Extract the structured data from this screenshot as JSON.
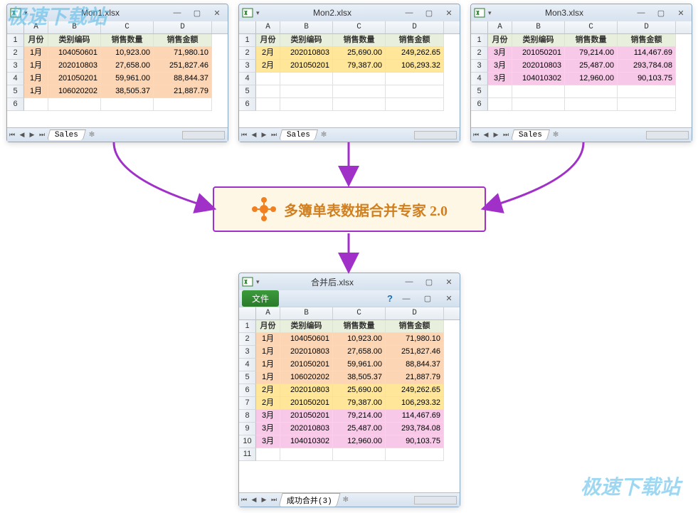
{
  "watermark": "极速下载站",
  "merge_tool": {
    "label": "多簿单表数据合并专家 2.0"
  },
  "windows": {
    "w1": {
      "title": "Mon1.xlsx",
      "sheet_tab": "Sales",
      "columns": [
        "A",
        "B",
        "C",
        "D"
      ],
      "headers": [
        "月份",
        "类别编码",
        "销售数量",
        "销售金额"
      ],
      "rows": [
        {
          "month": "1月",
          "code": "104050601",
          "qty": "10,923.00",
          "amt": "71,980.10"
        },
        {
          "month": "1月",
          "code": "202010803",
          "qty": "27,658.00",
          "amt": "251,827.46"
        },
        {
          "month": "1月",
          "code": "201050201",
          "qty": "59,961.00",
          "amt": "88,844.37"
        },
        {
          "month": "1月",
          "code": "106020202",
          "qty": "38,505.37",
          "amt": "21,887.79"
        }
      ],
      "row_bg": "bg-orange"
    },
    "w2": {
      "title": "Mon2.xlsx",
      "sheet_tab": "Sales",
      "columns": [
        "A",
        "B",
        "C",
        "D"
      ],
      "headers": [
        "月份",
        "类别编码",
        "销售数量",
        "销售金额"
      ],
      "rows": [
        {
          "month": "2月",
          "code": "202010803",
          "qty": "25,690.00",
          "amt": "249,262.65"
        },
        {
          "month": "2月",
          "code": "201050201",
          "qty": "79,387.00",
          "amt": "106,293.32"
        }
      ],
      "row_bg": "bg-yellow"
    },
    "w3": {
      "title": "Mon3.xlsx",
      "sheet_tab": "Sales",
      "columns": [
        "A",
        "B",
        "C",
        "D"
      ],
      "headers": [
        "月份",
        "类别编码",
        "销售数量",
        "销售金额"
      ],
      "rows": [
        {
          "month": "3月",
          "code": "201050201",
          "qty": "79,214.00",
          "amt": "114,467.69"
        },
        {
          "month": "3月",
          "code": "202010803",
          "qty": "25,487.00",
          "amt": "293,784.08"
        },
        {
          "month": "3月",
          "code": "104010302",
          "qty": "12,960.00",
          "amt": "90,103.75"
        }
      ],
      "row_bg": "bg-pink"
    },
    "w4": {
      "title": "合并后.xlsx",
      "sheet_tab": "成功合并(3)",
      "file_btn": "文件",
      "columns": [
        "A",
        "B",
        "C",
        "D"
      ],
      "headers": [
        "月份",
        "类别编码",
        "销售数量",
        "销售金额"
      ],
      "rows": [
        {
          "month": "1月",
          "code": "104050601",
          "qty": "10,923.00",
          "amt": "71,980.10",
          "bg": "bg-orange"
        },
        {
          "month": "1月",
          "code": "202010803",
          "qty": "27,658.00",
          "amt": "251,827.46",
          "bg": "bg-orange"
        },
        {
          "month": "1月",
          "code": "201050201",
          "qty": "59,961.00",
          "amt": "88,844.37",
          "bg": "bg-orange"
        },
        {
          "month": "1月",
          "code": "106020202",
          "qty": "38,505.37",
          "amt": "21,887.79",
          "bg": "bg-orange"
        },
        {
          "month": "2月",
          "code": "202010803",
          "qty": "25,690.00",
          "amt": "249,262.65",
          "bg": "bg-yellow"
        },
        {
          "month": "2月",
          "code": "201050201",
          "qty": "79,387.00",
          "amt": "106,293.32",
          "bg": "bg-yellow"
        },
        {
          "month": "3月",
          "code": "201050201",
          "qty": "79,214.00",
          "amt": "114,467.69",
          "bg": "bg-pink"
        },
        {
          "month": "3月",
          "code": "202010803",
          "qty": "25,487.00",
          "amt": "293,784.08",
          "bg": "bg-pink"
        },
        {
          "month": "3月",
          "code": "104010302",
          "qty": "12,960.00",
          "amt": "90,103.75",
          "bg": "bg-pink"
        }
      ]
    }
  }
}
